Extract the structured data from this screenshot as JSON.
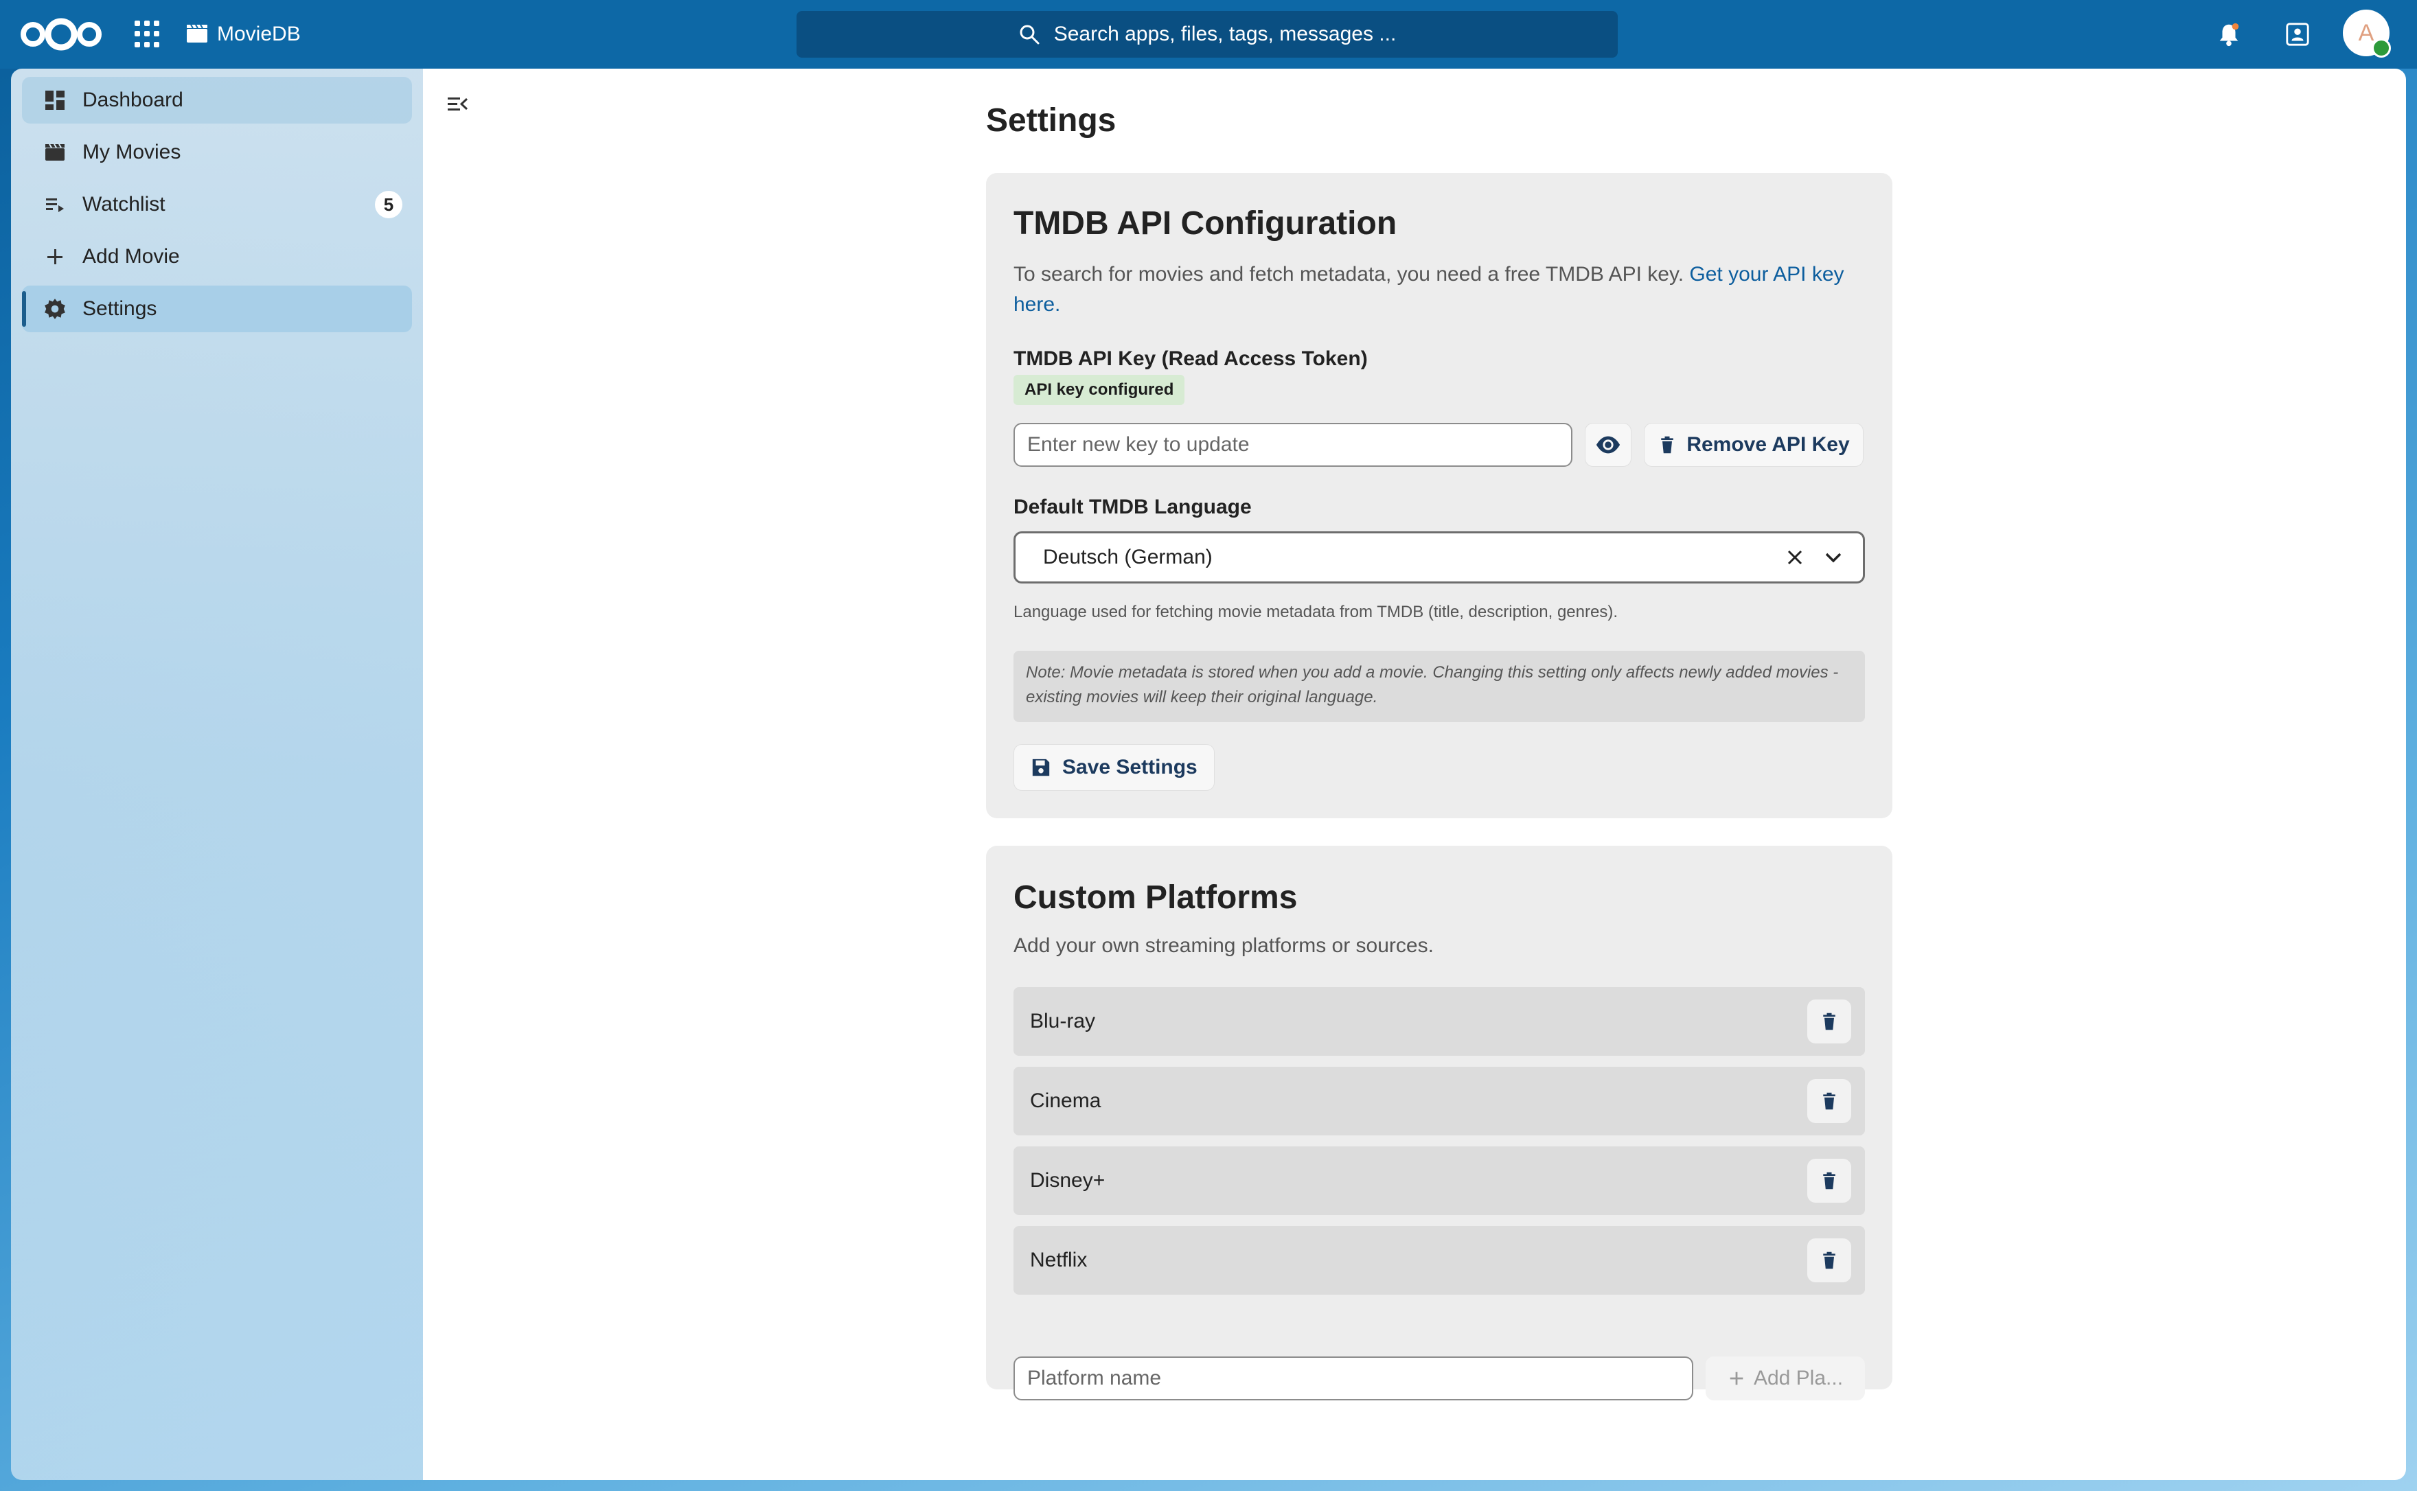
{
  "header": {
    "app_name": "MovieDB",
    "search_placeholder": "Search apps, files, tags, messages ...",
    "avatar_initial": "A"
  },
  "sidebar": {
    "items": [
      {
        "label": "Dashboard",
        "icon": "dashboard-icon"
      },
      {
        "label": "My Movies",
        "icon": "clapperboard-icon"
      },
      {
        "label": "Watchlist",
        "icon": "playlist-icon",
        "count": "5"
      },
      {
        "label": "Add Movie",
        "icon": "plus-icon"
      },
      {
        "label": "Settings",
        "icon": "gear-icon"
      }
    ]
  },
  "main": {
    "page_title": "Settings",
    "tmdb": {
      "heading": "TMDB API Configuration",
      "intro_text": "To search for movies and fetch metadata, you need a free TMDB API key.",
      "intro_link": "Get your API key here.",
      "api_key_label": "TMDB API Key (Read Access Token)",
      "api_key_status": "API key configured",
      "api_key_placeholder": "Enter new key to update",
      "remove_label": "Remove API Key",
      "language_label": "Default TMDB Language",
      "language_value": "Deutsch (German)",
      "language_hint": "Language used for fetching movie metadata from TMDB (title, description, genres).",
      "note": "Note: Movie metadata is stored when you add a movie. Changing this setting only affects newly added movies - existing movies will keep their original language.",
      "save_label": "Save Settings"
    },
    "platforms": {
      "heading": "Custom Platforms",
      "description": "Add your own streaming platforms or sources.",
      "items": [
        "Blu-ray",
        "Cinema",
        "Disney+",
        "Netflix"
      ],
      "input_placeholder": "Platform name",
      "add_label": "Add Pla..."
    }
  },
  "colors": {
    "header": "#0d68a6",
    "accent": "#0d5e9e",
    "badge_bg": "#d7ebd3"
  }
}
